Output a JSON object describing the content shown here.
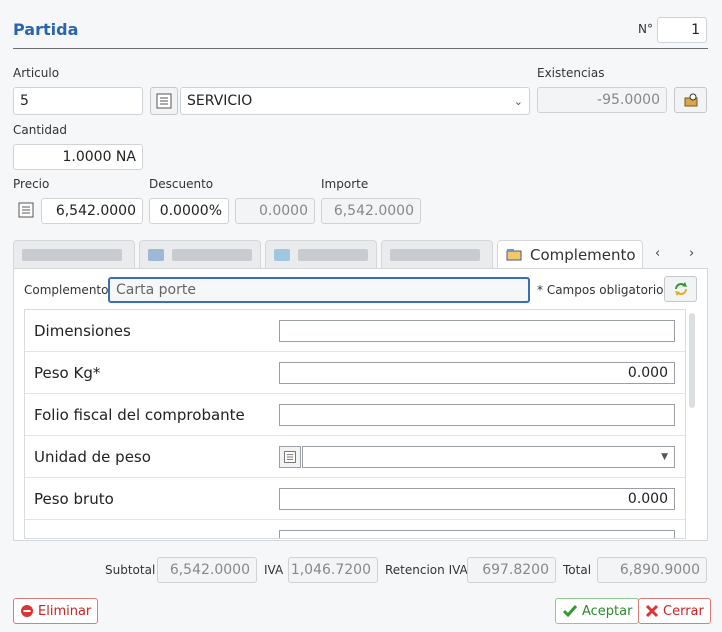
{
  "header": {
    "title": "Partida",
    "number_label": "N°",
    "number_value": "1"
  },
  "articulo": {
    "label": "Articulo",
    "code": "5",
    "selected": "SERVICIO"
  },
  "existencias": {
    "label": "Existencias",
    "value": "-95.0000"
  },
  "cantidad": {
    "label": "Cantidad",
    "value": "1.0000 NA"
  },
  "precio": {
    "label": "Precio",
    "value": "6,542.0000"
  },
  "descuento": {
    "label": "Descuento",
    "percent": "0.0000%",
    "amount": "0.0000"
  },
  "importe": {
    "label": "Importe",
    "value": "6,542.0000"
  },
  "tabs": {
    "active_label": "Complemento"
  },
  "complemento": {
    "label": "Complemento",
    "value": "Carta porte",
    "required_note": "* Campos obligatorios"
  },
  "rows": [
    {
      "label": "Dimensiones",
      "value": ""
    },
    {
      "label": "Peso Kg*",
      "value": "0.000"
    },
    {
      "label": "Folio fiscal del comprobante",
      "value": ""
    },
    {
      "label": "Unidad de peso",
      "value": ""
    },
    {
      "label": "Peso bruto",
      "value": "0.000"
    }
  ],
  "totals": {
    "subtotal_label": "Subtotal",
    "subtotal": "6,542.0000",
    "iva_label": "IVA",
    "iva": "1,046.7200",
    "ret_label": "Retencion IVA",
    "ret": "697.8200",
    "total_label": "Total",
    "total": "6,890.9000"
  },
  "actions": {
    "delete": "Eliminar",
    "accept": "Aceptar",
    "close": "Cerrar"
  },
  "colors": {
    "title": "#2a66b0",
    "delete": "#cc2222",
    "accept": "#2d8a2d"
  }
}
